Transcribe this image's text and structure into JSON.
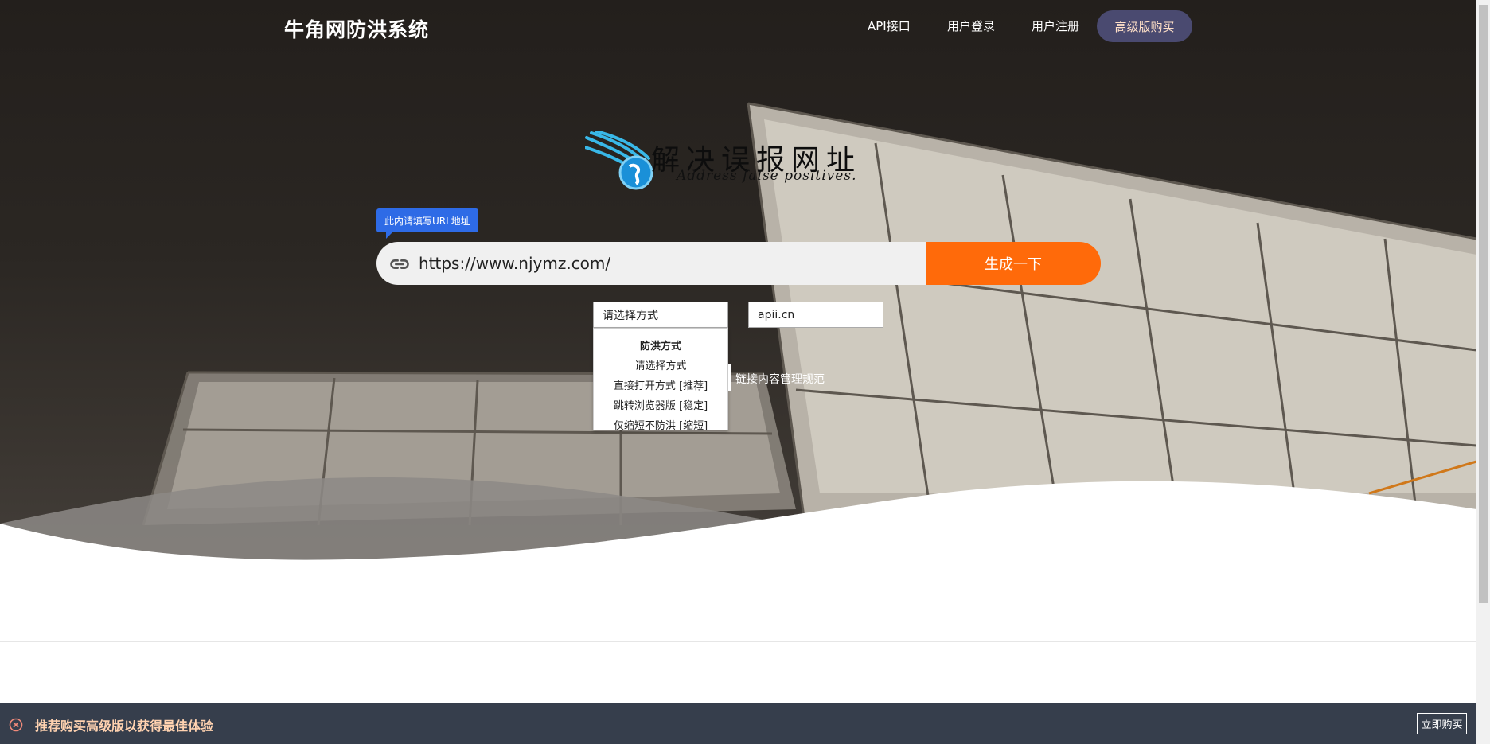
{
  "header": {
    "brand": "牛角网防洪系统",
    "nav": [
      "API接口",
      "用户登录",
      "用户注册"
    ],
    "buy": "高级版购买"
  },
  "logo": {
    "title": "解决误报网址",
    "subtitle": "Address false positives."
  },
  "form": {
    "tooltip": "此内请填写URL地址",
    "url_value": "https://www.njymz.com/",
    "generate": "生成一下",
    "select_current": "请选择方式",
    "select_options": {
      "group": "防洪方式",
      "items": [
        "请选择方式",
        "直接打开方式 [推荐]",
        "跳转浏览器版 [稳定]",
        "仅缩短不防洪 [缩短]"
      ]
    },
    "domain": "apii.cn",
    "policy": "链接内容管理规范"
  },
  "notice": {
    "text": "推荐购买高级版以获得最佳体验",
    "button": "立即购买"
  },
  "colors": {
    "accent": "#ff6a0a",
    "tooltip": "#2e6be6",
    "buy_button": "#4a4a70",
    "notice_bg": "#363e4c"
  },
  "icons": {
    "url": "link-icon",
    "notice": "close-circle-icon"
  }
}
